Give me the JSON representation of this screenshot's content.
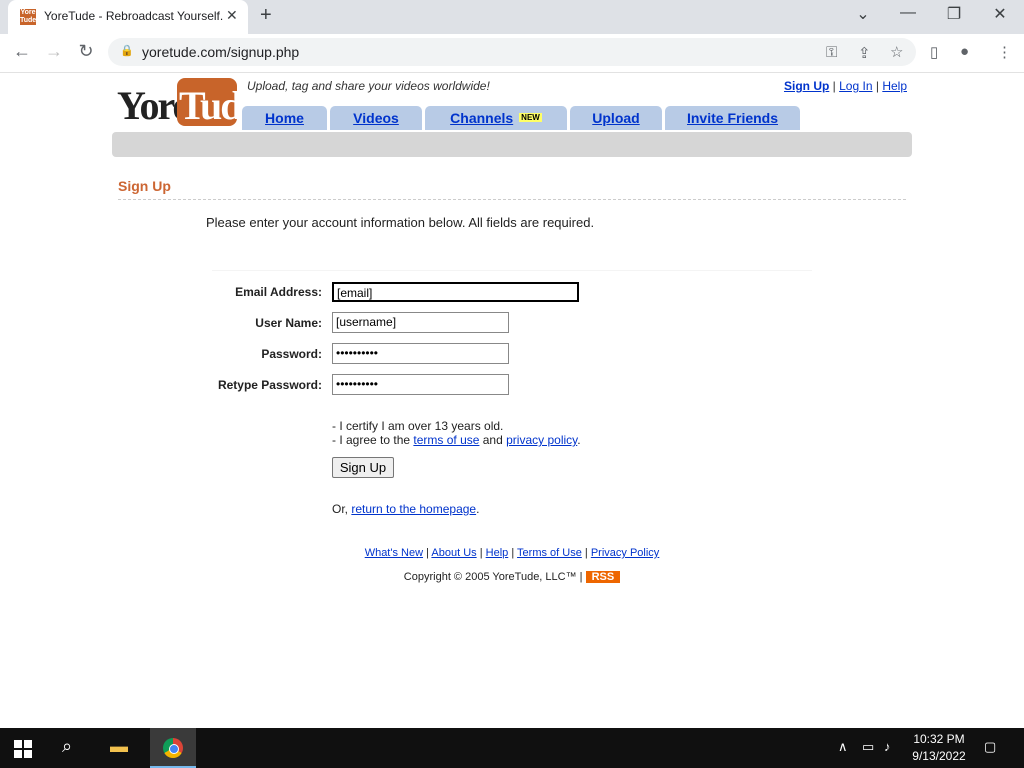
{
  "browser": {
    "tab_title": "YoreTude - Rebroadcast Yourself.",
    "favicon_text": "Yore Tude",
    "url": "yoretude.com/signup.php",
    "icons": [
      "back-icon",
      "forward-icon",
      "reload-icon",
      "lock-icon",
      "key-icon",
      "share-icon",
      "star-icon",
      "sidepanel-icon",
      "profile-icon",
      "menu-icon"
    ]
  },
  "site": {
    "logo_yore": "Yore",
    "logo_tube": "Tude",
    "tagline": "Upload, tag and share your videos worldwide!",
    "top_links": {
      "signup": "Sign Up",
      "login": "Log In",
      "help": "Help",
      "sep": "|"
    },
    "nav": {
      "home": "Home",
      "videos": "Videos",
      "channels": "Channels",
      "channels_badge": "NEW",
      "upload": "Upload",
      "invite": "Invite Friends"
    },
    "accent_color": "#cc6633"
  },
  "signup": {
    "heading": "Sign Up",
    "intro": "Please enter your account information below. All fields are required.",
    "labels": {
      "email": "Email Address:",
      "username": "User Name:",
      "password": "Password:",
      "retype": "Retype Password:"
    },
    "values": {
      "email": "[email]",
      "username": "[username]",
      "password": "••••••••••",
      "retype": "••••••••••"
    },
    "certify_line1": "- I certify I am over 13 years old.",
    "agree_prefix": "- I agree to the ",
    "terms_link": "terms of use",
    "agree_mid": " and ",
    "privacy_link": "privacy policy",
    "agree_suffix": ".",
    "submit_label": "Sign Up",
    "or_prefix": "Or, ",
    "return_link": "return to the homepage",
    "or_suffix": "."
  },
  "footer": {
    "links": [
      "What's New",
      "About Us",
      "Help",
      "Terms of Use",
      "Privacy Policy"
    ],
    "sep": " | ",
    "copyright": "Copyright © 2005 YoreTude, LLC™ | ",
    "rss": "RSS"
  },
  "taskbar": {
    "time": "10:32 PM",
    "date": "9/13/2022"
  }
}
